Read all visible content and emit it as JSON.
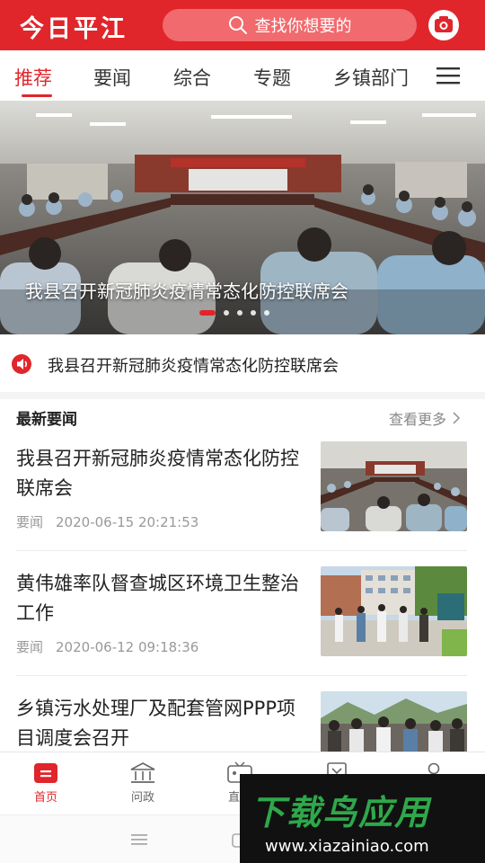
{
  "header": {
    "logo": "今日平江",
    "search_placeholder": "查找你想要的",
    "bg_color": "#e0262b"
  },
  "tabs": [
    {
      "label": "推荐",
      "active": true
    },
    {
      "label": "要闻",
      "active": false
    },
    {
      "label": "综合",
      "active": false
    },
    {
      "label": "专题",
      "active": false
    },
    {
      "label": "乡镇部门",
      "active": false
    }
  ],
  "banner": {
    "caption": "我县召开新冠肺炎疫情常态化防控联席会",
    "slide_count": 5,
    "active_slide": 1
  },
  "notice": {
    "text": "我县召开新冠肺炎疫情常态化防控联席会"
  },
  "section": {
    "title": "最新要闻",
    "more": "查看更多"
  },
  "news": [
    {
      "title": "我县召开新冠肺炎疫情常态化防控联席会",
      "category": "要闻",
      "time": "2020-06-15 20:21:53"
    },
    {
      "title": "黄伟雄率队督查城区环境卫生整治工作",
      "category": "要闻",
      "time": "2020-06-12 09:18:36"
    },
    {
      "title": "乡镇污水处理厂及配套管网PPP项目调度会召开",
      "category": "",
      "time": ""
    }
  ],
  "bottom_nav": [
    {
      "label": "首页",
      "icon": "home-icon",
      "active": true
    },
    {
      "label": "问政",
      "icon": "government-icon",
      "active": false
    },
    {
      "label": "直播",
      "icon": "live-icon",
      "active": false
    },
    {
      "label": "",
      "icon": "services-icon",
      "active": false
    },
    {
      "label": "",
      "icon": "user-icon",
      "active": false
    }
  ],
  "watermark": {
    "title": "下载鸟应用",
    "url": "www.xiazainiao.com"
  }
}
